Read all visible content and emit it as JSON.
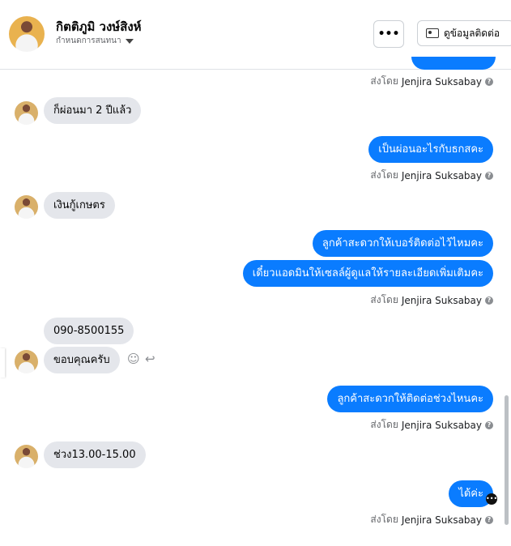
{
  "header": {
    "name": "กิตติภูมิ วงษ์สิงห์",
    "status": "กำหนดการสนทนา",
    "more_label": "•••",
    "contact_label": "ดูข้อมูลติดต่อ"
  },
  "messages": {
    "sent_prefix": "ส่งโดย",
    "sender": "Jenjira Suksabay",
    "m1": "ก็ผ่อนมา 2 ปีแล้ว",
    "m2": "เป็นผ่อนอะไรกับธกสคะ",
    "m3": "เงินกู้เกษตร",
    "m4": "ลูกค้าสะดวกให้เบอร์ติดต่อไว้ไหมคะ",
    "m5": "เดี๋ยวแอดมินให้เซลล์ผู้ดูแลให้รายละเอียดเพิ่มเติมคะ",
    "m6": "090-8500155",
    "m7": "ขอบคุณครับ",
    "m8": "ลูกค้าสะดวกให้ติดต่อช่วงไหนคะ",
    "m9": "ช่วง13.00-15.00",
    "m10": "ได้ค่ะ"
  },
  "icons": {
    "smile": "☺",
    "reply": "↩",
    "info": "?"
  }
}
